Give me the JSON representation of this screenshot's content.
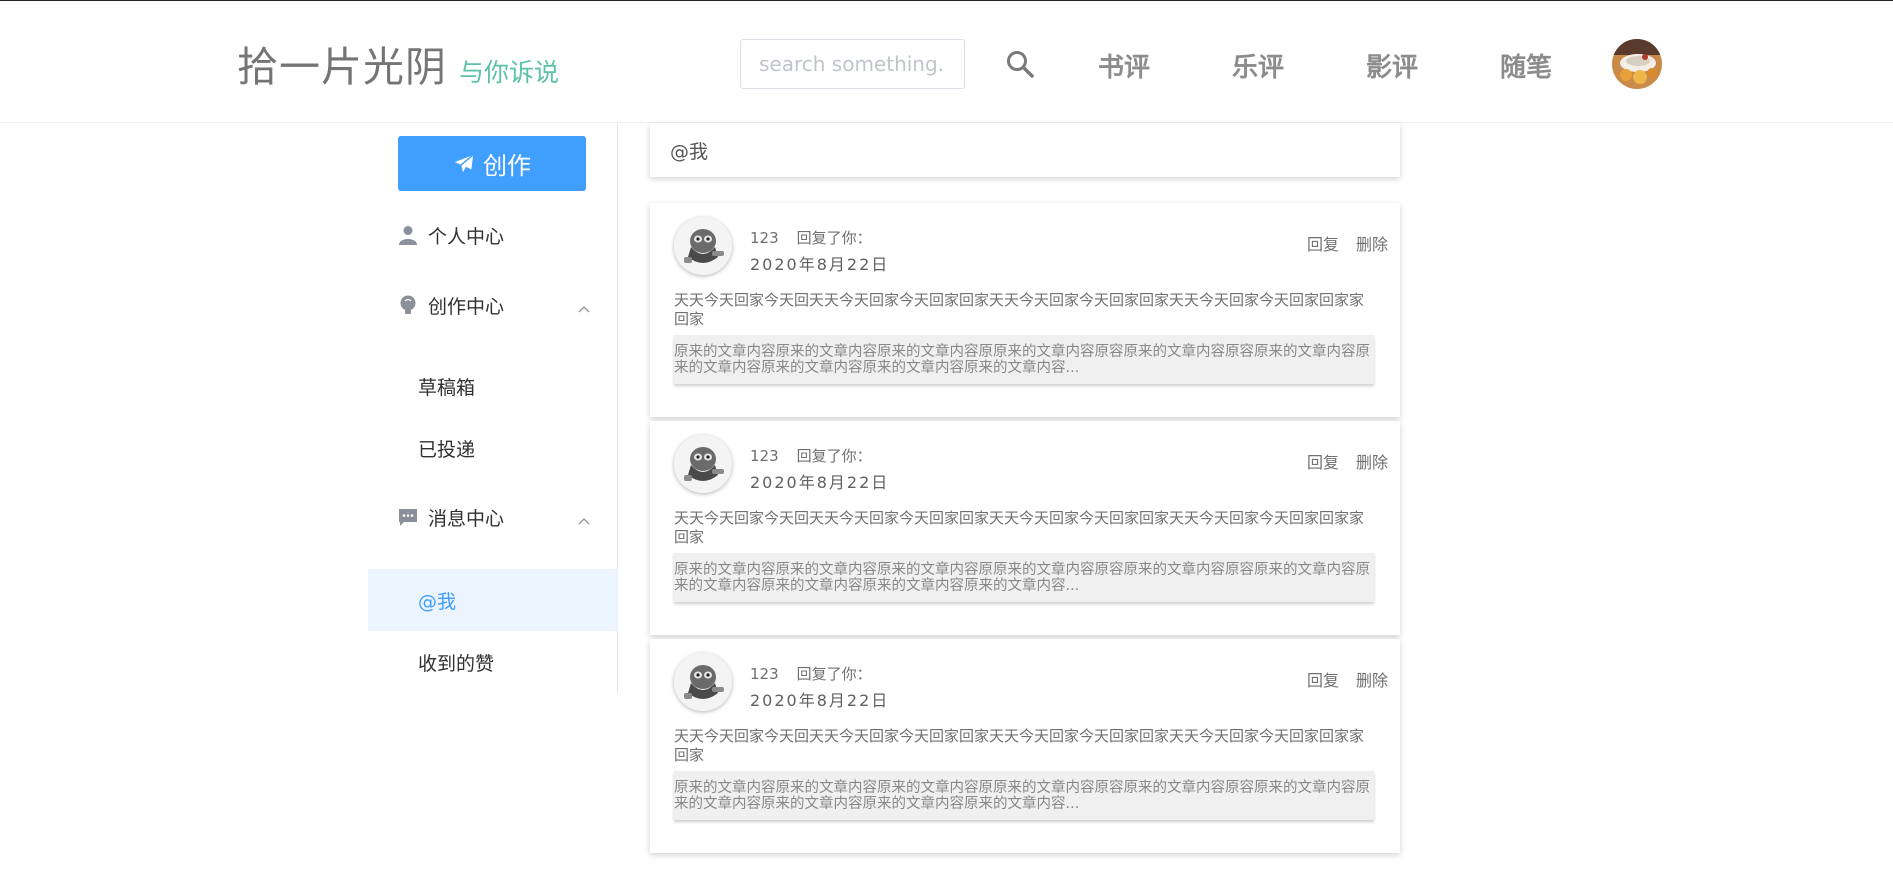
{
  "header": {
    "logo_main": "拾一片光阴",
    "logo_sub": "与你诉说",
    "search_placeholder": "search something...",
    "nav": [
      "书评",
      "乐评",
      "影评",
      "随笔"
    ]
  },
  "sidebar": {
    "create_label": "创作",
    "personal_center": "个人中心",
    "creation_center": "创作中心",
    "drafts": "草稿箱",
    "submitted": "已投递",
    "message_center": "消息中心",
    "at_me": "@我",
    "likes_received": "收到的赞"
  },
  "main": {
    "section_title": "@我",
    "messages": [
      {
        "user": "123",
        "action": "回复了你：",
        "date": "2020年8月22日",
        "content": "天天今天回家今天回天天今天回家今天回家回家天天今天回家今天回家回家天天今天回家今天回家回家家回家",
        "quote": "原来的文章内容原来的文章内容原来的文章内容原原来的文章内容原容原来的文章内容原容原来的文章内容原来的文章内容原来的文章内容原来的文章内容原来的文章内容...",
        "reply": "回复",
        "delete": "删除"
      },
      {
        "user": "123",
        "action": "回复了你：",
        "date": "2020年8月22日",
        "content": "天天今天回家今天回天天今天回家今天回家回家天天今天回家今天回家回家天天今天回家今天回家回家家回家",
        "quote": "原来的文章内容原来的文章内容原来的文章内容原原来的文章内容原容原来的文章内容原容原来的文章内容原来的文章内容原来的文章内容原来的文章内容原来的文章内容...",
        "reply": "回复",
        "delete": "删除"
      },
      {
        "user": "123",
        "action": "回复了你：",
        "date": "2020年8月22日",
        "content": "天天今天回家今天回天天今天回家今天回家回家天天今天回家今天回家回家天天今天回家今天回家回家家回家",
        "quote": "原来的文章内容原来的文章内容原来的文章内容原原来的文章内容原容原来的文章内容原容原来的文章内容原来的文章内容原来的文章内容原来的文章内容原来的文章内容...",
        "reply": "回复",
        "delete": "删除"
      }
    ]
  },
  "colors": {
    "accent": "#409eff",
    "logo_sub": "#5cc2a8",
    "active_bg": "#ecf5ff"
  },
  "icons": [
    "search-icon",
    "paper-plane-icon",
    "user-icon",
    "lightbulb-icon",
    "chat-icon",
    "chevron-up-icon"
  ]
}
